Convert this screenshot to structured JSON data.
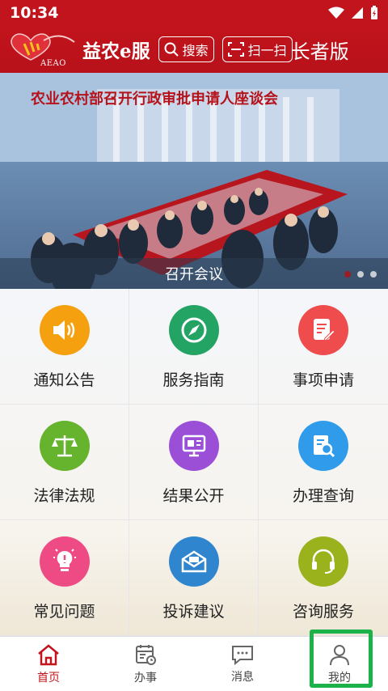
{
  "status_bar": {
    "time": "10:34"
  },
  "header": {
    "logo_text": "AEAO",
    "brand": "益农e服",
    "search_label": "搜索",
    "scan_label": "扫一扫",
    "elder_mode": "长者版"
  },
  "banner": {
    "headline": "农业农村部召开行政审批申请人座谈会",
    "caption": "召开会议",
    "slides": 3,
    "active_slide": 1
  },
  "grid": {
    "items": [
      {
        "label": "通知公告",
        "icon": "speaker-icon",
        "color": "#f5a10f"
      },
      {
        "label": "服务指南",
        "icon": "compass-icon",
        "color": "#23a464"
      },
      {
        "label": "事项申请",
        "icon": "document-edit-icon",
        "color": "#ef4d4d"
      },
      {
        "label": "法律法规",
        "icon": "scale-icon",
        "color": "#66b32e"
      },
      {
        "label": "结果公开",
        "icon": "monitor-icon",
        "color": "#9b4fd6"
      },
      {
        "label": "办理查询",
        "icon": "search-document-icon",
        "color": "#2f9bea"
      },
      {
        "label": "常见问题",
        "icon": "lightbulb-icon",
        "color": "#ee4b84"
      },
      {
        "label": "投诉建议",
        "icon": "envelope-icon",
        "color": "#2f86cf"
      },
      {
        "label": "咨询服务",
        "icon": "headset-icon",
        "color": "#9ab31d"
      }
    ]
  },
  "tabbar": {
    "items": [
      {
        "label": "首页",
        "icon": "home-icon",
        "active": true
      },
      {
        "label": "办事",
        "icon": "calendar-icon",
        "active": false
      },
      {
        "label": "消息",
        "icon": "chat-icon",
        "active": false
      },
      {
        "label": "我的",
        "icon": "user-icon",
        "active": false
      }
    ]
  },
  "colors": {
    "brand_red": "#c2141c",
    "highlight_green": "#1bb24a"
  }
}
